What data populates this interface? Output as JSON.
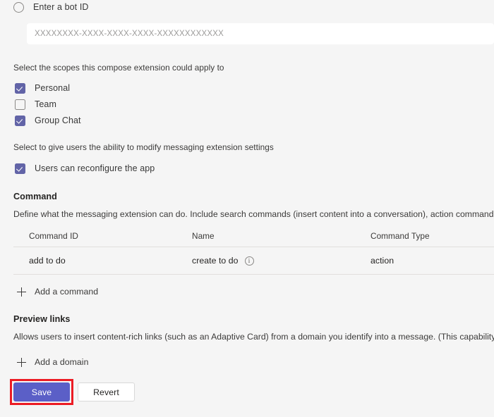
{
  "bot_id_section": {
    "radio_label": "Enter a bot ID",
    "radio_checked": false,
    "input_placeholder": "XXXXXXXX-XXXX-XXXX-XXXX-XXXXXXXXXXXX",
    "input_value": ""
  },
  "scopes_section": {
    "label": "Select the scopes this compose extension could apply to",
    "items": [
      {
        "label": "Personal",
        "checked": true
      },
      {
        "label": "Team",
        "checked": false
      },
      {
        "label": "Group Chat",
        "checked": true
      }
    ]
  },
  "reconfigure_section": {
    "label": "Select to give users the ability to modify messaging extension settings",
    "items": [
      {
        "label": "Users can reconfigure the app",
        "checked": true
      }
    ]
  },
  "command_section": {
    "heading": "Command",
    "description": "Define what the messaging extension can do. Include search commands (insert content into a conversation), action commands (a",
    "columns": [
      "Command ID",
      "Name",
      "Command Type"
    ],
    "rows": [
      {
        "command_id": "add to do",
        "name": "create to do",
        "name_info_icon": "info-icon",
        "command_type": "action"
      }
    ],
    "add_command_label": "Add a command"
  },
  "preview_links_section": {
    "heading": "Preview links",
    "description": "Allows users to insert content-rich links (such as an Adaptive Card) from a domain you identify into a message. (This capability is",
    "add_domain_label": "Add a domain"
  },
  "footer": {
    "save_label": "Save",
    "revert_label": "Revert"
  },
  "colors": {
    "accent_purple": "#6264a7",
    "save_button": "#5b5fc7",
    "highlight_red": "#ec1c24",
    "page_background": "#f5f5f5",
    "divider": "#e1dfdd"
  }
}
